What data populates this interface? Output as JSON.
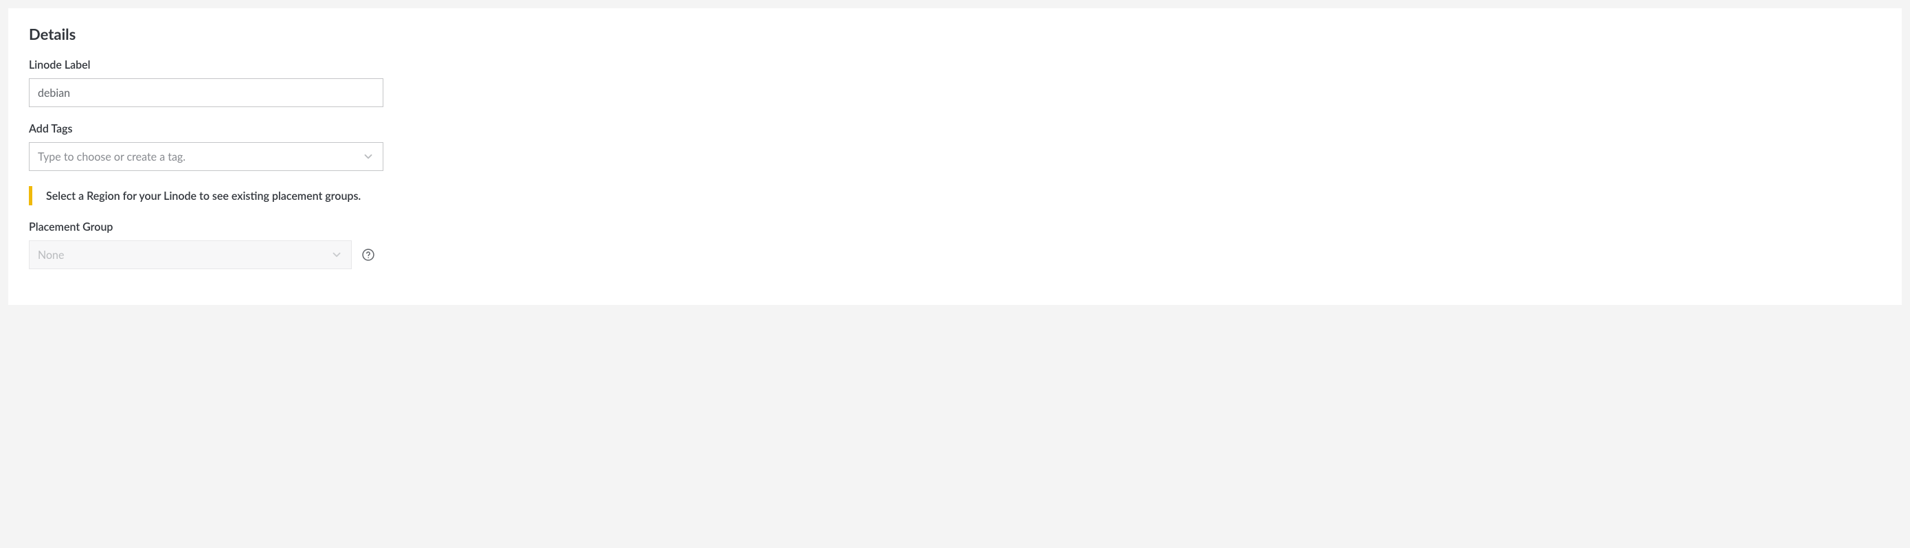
{
  "section": {
    "title": "Details"
  },
  "linodeLabel": {
    "label": "Linode Label",
    "value": "debian"
  },
  "addTags": {
    "label": "Add Tags",
    "placeholder": "Type to choose or create a tag."
  },
  "notice": {
    "text": "Select a Region for your Linode to see existing placement groups."
  },
  "placementGroup": {
    "label": "Placement Group",
    "value": "None"
  },
  "colors": {
    "noticeAccent": "#f0b90b"
  }
}
